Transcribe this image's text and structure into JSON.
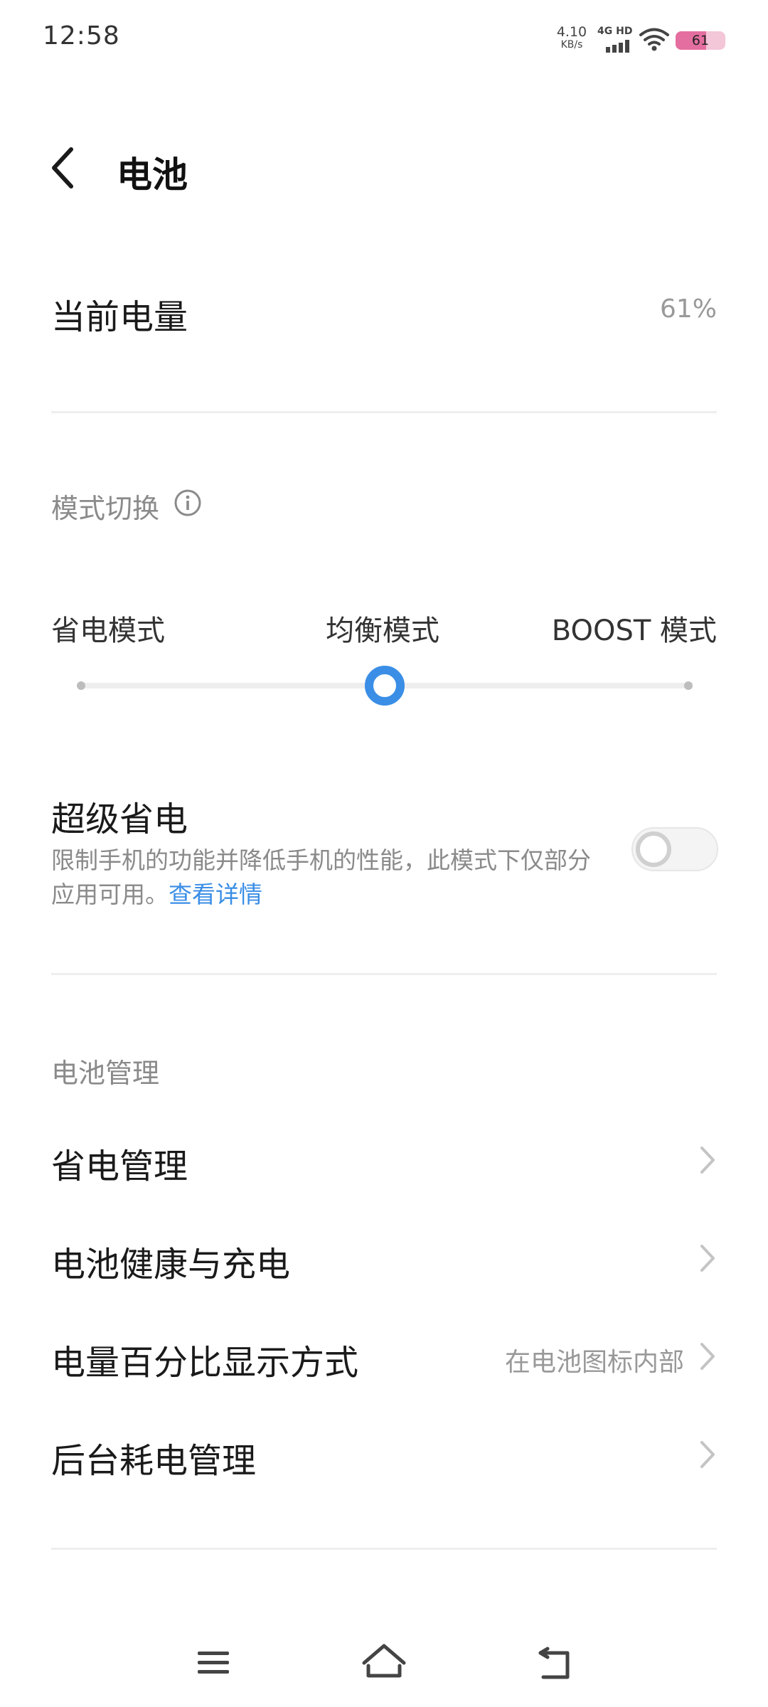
{
  "status_bar": {
    "time": "12:58",
    "net_speed_value": "4.10",
    "net_speed_unit": "KB/s",
    "signal_label": "4G HD",
    "battery_level": "61",
    "battery_fraction": 0.61,
    "icons": [
      "signal-bars-icon",
      "wifi-icon",
      "battery-icon"
    ]
  },
  "header": {
    "title": "电池",
    "back_icon": "chevron-left-icon"
  },
  "current_charge": {
    "label": "当前电量",
    "value": "61%"
  },
  "mode_section": {
    "label": "模式切换",
    "info_icon": "info-icon",
    "modes": [
      "省电模式",
      "均衡模式",
      "BOOST 模式"
    ],
    "selected_index": 1
  },
  "super_saver": {
    "title": "超级省电",
    "description": "限制手机的功能并降低手机的性能，此模式下仅部分应用可用。",
    "link": "查看详情",
    "enabled": false
  },
  "battery_management": {
    "label": "电池管理",
    "items": [
      {
        "label": "省电管理",
        "value": ""
      },
      {
        "label": "电池健康与充电",
        "value": ""
      },
      {
        "label": "电量百分比显示方式",
        "value": "在电池图标内部"
      },
      {
        "label": "后台耗电管理",
        "value": ""
      }
    ]
  },
  "nav_bar": {
    "icons": [
      "menu-icon",
      "home-icon",
      "back-icon"
    ]
  },
  "colors": {
    "accent": "#3a8ee6",
    "battery_fill": "#e46ea0"
  }
}
